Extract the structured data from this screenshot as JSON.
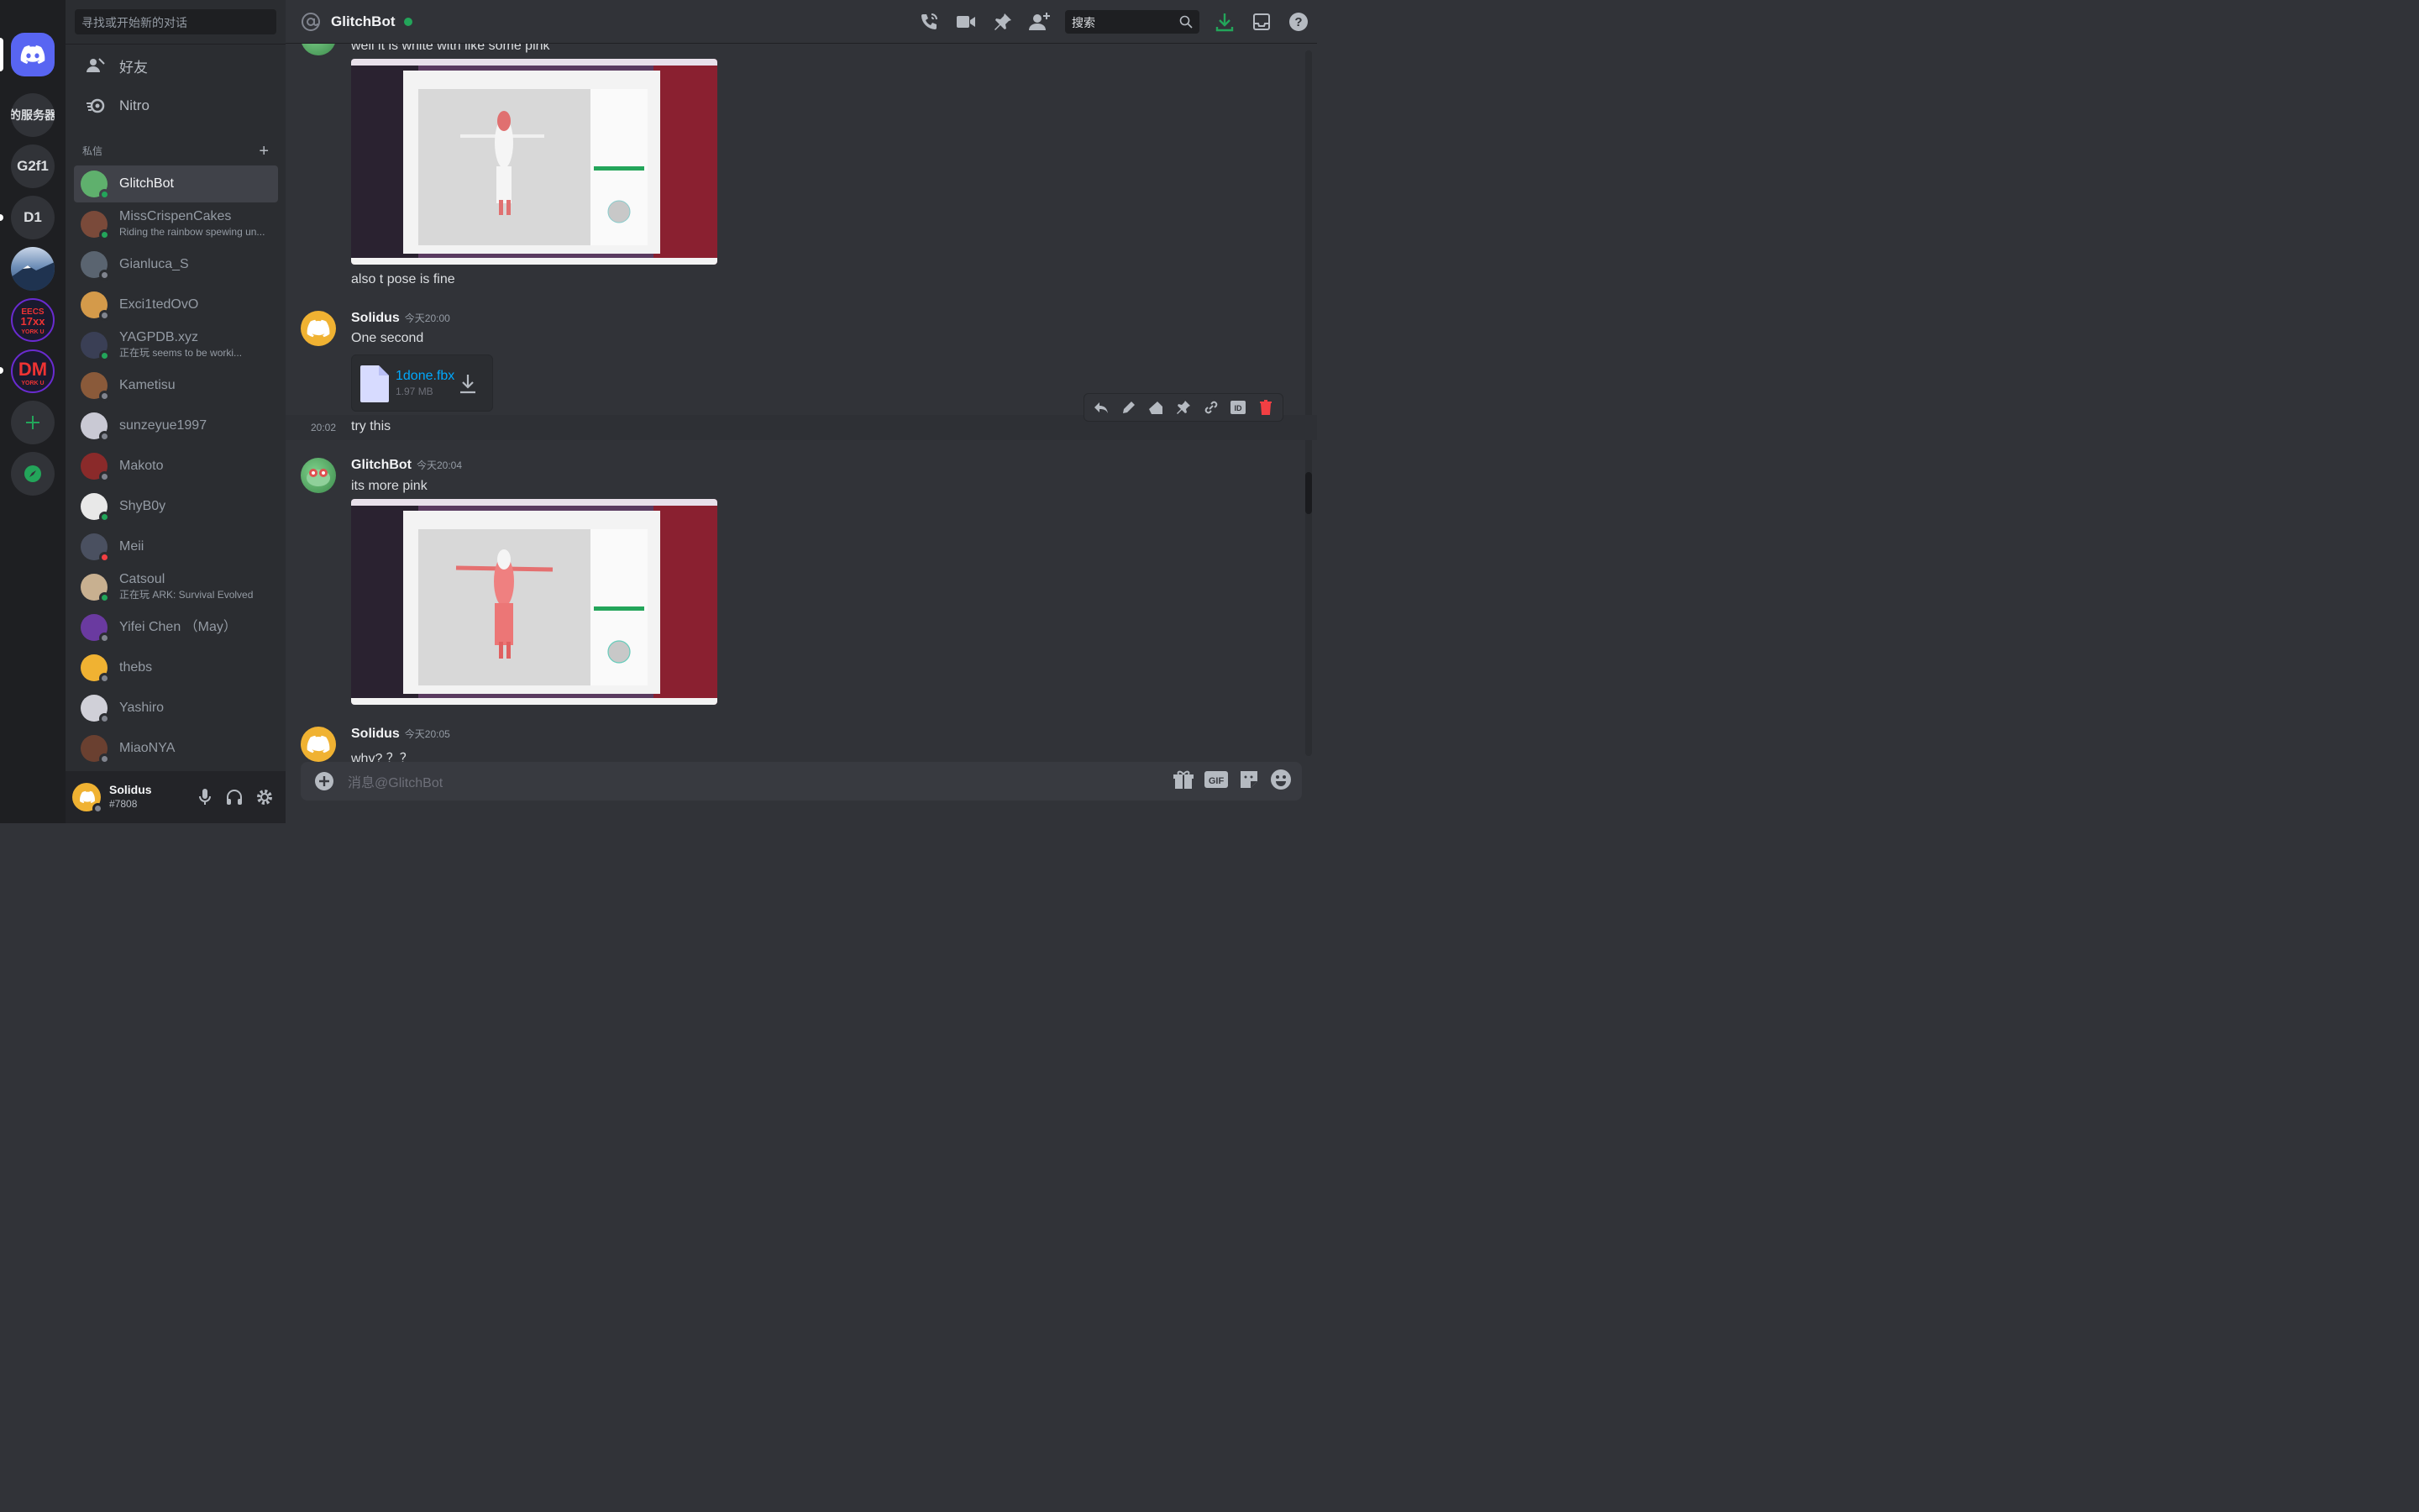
{
  "servers": [
    {
      "label": ""
    },
    {
      "label": "的服务器"
    },
    {
      "label": "G2f1"
    },
    {
      "label": "D1"
    },
    {
      "label": ""
    },
    {
      "label": "EECS 17xx YORK U"
    },
    {
      "label": "DM YORK U"
    }
  ],
  "sidebar": {
    "search_placeholder": "寻找或开始新的对话",
    "friends_label": "好友",
    "nitro_label": "Nitro",
    "dm_header": "私信",
    "dms": [
      {
        "name": "GlitchBot",
        "sub": "",
        "status": "online"
      },
      {
        "name": "MissCrispenCakes",
        "sub": "Riding the rainbow spewing un...",
        "status": "online"
      },
      {
        "name": "Gianluca_S",
        "sub": "",
        "status": "offline"
      },
      {
        "name": "Exci1tedOvO",
        "sub": "",
        "status": "offline"
      },
      {
        "name": "YAGPDB.xyz",
        "sub": "正在玩 seems to be worki...",
        "status": "online"
      },
      {
        "name": "Kametisu",
        "sub": "",
        "status": "offline"
      },
      {
        "name": "sunzeyue1997",
        "sub": "",
        "status": "offline"
      },
      {
        "name": "Makoto",
        "sub": "",
        "status": "offline"
      },
      {
        "name": "ShyB0y",
        "sub": "",
        "status": "online"
      },
      {
        "name": "Meii",
        "sub": "",
        "status": "dnd"
      },
      {
        "name": "Catsoul",
        "sub": "正在玩 ARK: Survival Evolved",
        "status": "online"
      },
      {
        "name": "Yifei Chen （May）",
        "sub": "",
        "status": "offline"
      },
      {
        "name": "thebs",
        "sub": "",
        "status": "offline"
      },
      {
        "name": "Yashiro",
        "sub": "",
        "status": "offline"
      },
      {
        "name": "MiaoNYA",
        "sub": "",
        "status": "offline"
      }
    ],
    "user": {
      "name": "Solidus",
      "tag": "#7808"
    }
  },
  "header": {
    "title": "GlitchBot",
    "search_placeholder": "搜索"
  },
  "messages": {
    "m1_text": "well it is white with like some pink",
    "m2_text": "also t pose is fine",
    "m3_author": "Solidus",
    "m3_time": "今天20:00",
    "m3_text": "One second",
    "file_name": "1done.fbx",
    "file_size": "1.97 MB",
    "m4_time": "20:02",
    "m4_text": "try this",
    "m5_author": "GlitchBot",
    "m5_time": "今天20:04",
    "m5_text": "its more pink",
    "m6_author": "Solidus",
    "m6_time": "今天20:05",
    "m6_text": "why? ？？"
  },
  "composer": {
    "placeholder": "消息@GlitchBot"
  },
  "colors": {
    "accent": "#5865f2",
    "online": "#23a55a",
    "dnd": "#f23f43",
    "link": "#00a8fc",
    "download": "#23a55a"
  }
}
